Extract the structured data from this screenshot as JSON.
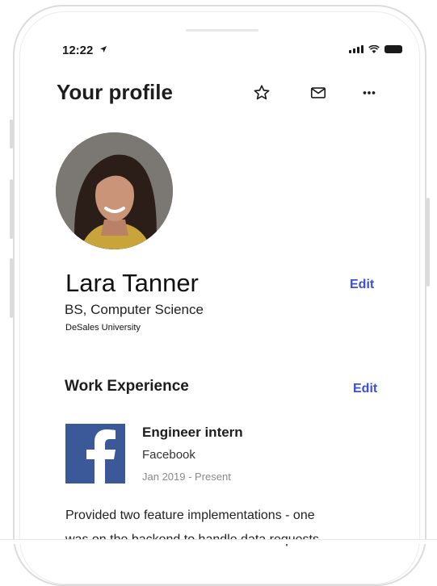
{
  "status_bar": {
    "time": "12:22",
    "location_arrow": "location-arrow-icon"
  },
  "header": {
    "title": "Your profile",
    "icons": [
      "star-icon",
      "mail-icon",
      "more-icon"
    ]
  },
  "profile": {
    "name": "Lara Tanner",
    "degree": "BS, Computer Science",
    "school": "DeSales University",
    "edit_label": "Edit"
  },
  "work": {
    "section_title": "Work Experience",
    "edit_label": "Edit",
    "items": [
      {
        "title": "Engineer intern",
        "company": "Facebook",
        "dates": "Jan 2019 - Present",
        "description_lines": [
          "Provided two feature implementations - one",
          "was on the backend to handle data requests"
        ]
      }
    ]
  },
  "colors": {
    "accent": "#3a4fd8",
    "facebook": "#3b5998",
    "text": "#1d1d1d"
  }
}
